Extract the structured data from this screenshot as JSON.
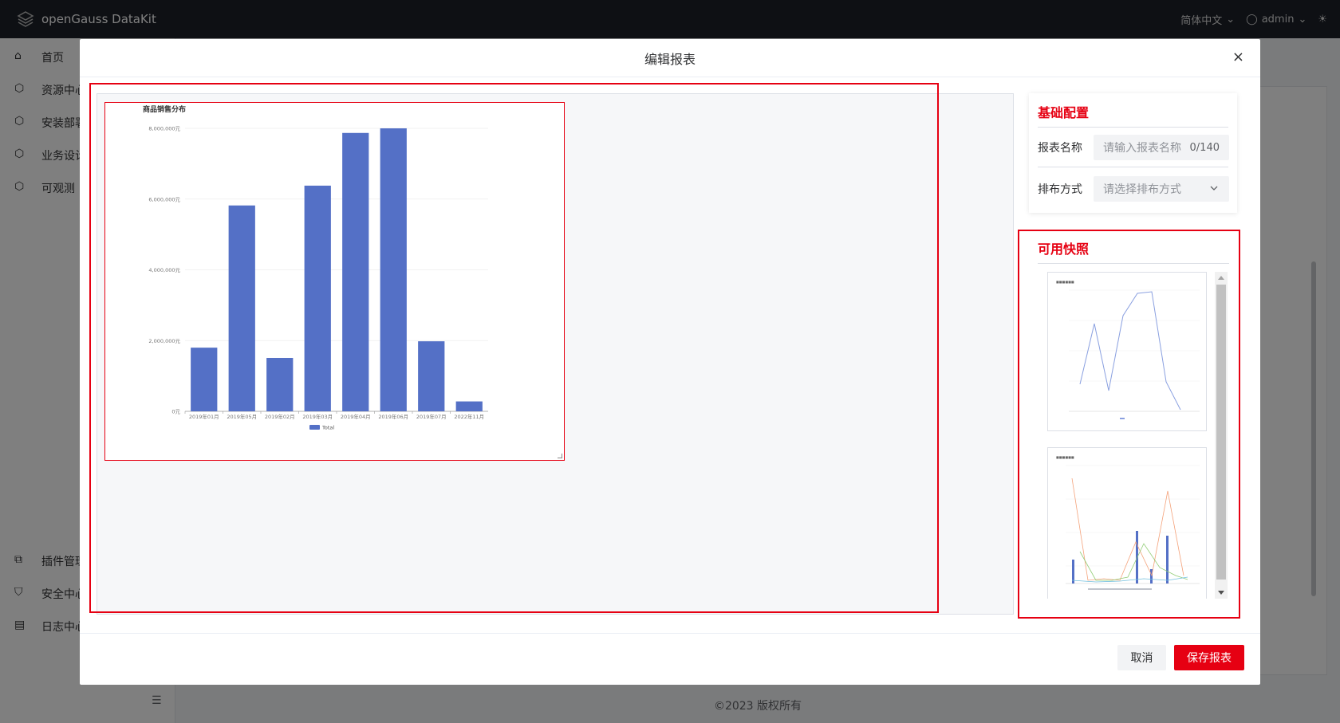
{
  "app": {
    "title": "openGauss DataKit",
    "language": "简体中文",
    "user": "admin"
  },
  "sidebar": {
    "items": [
      {
        "label": "首页",
        "icon": "home-icon"
      },
      {
        "label": "资源中心",
        "icon": "resource-icon"
      },
      {
        "label": "安装部署",
        "icon": "install-icon"
      },
      {
        "label": "业务设计",
        "icon": "design-icon"
      },
      {
        "label": "可观测",
        "icon": "observe-icon"
      },
      {
        "label": "插件管理",
        "icon": "plugin-icon"
      },
      {
        "label": "安全中心",
        "icon": "shield-icon"
      },
      {
        "label": "日志中心",
        "icon": "log-icon"
      }
    ]
  },
  "footer": {
    "copyright": "©2023 版权所有"
  },
  "modal": {
    "title": "编辑报表",
    "close": "×",
    "config": {
      "section_title": "基础配置",
      "name_label": "报表名称",
      "name_placeholder": "请输入报表名称",
      "name_count": "0/140",
      "layout_label": "排布方式",
      "layout_placeholder": "请选择排布方式"
    },
    "snapshots": {
      "section_title": "可用快照"
    },
    "buttons": {
      "cancel": "取消",
      "save": "保存报表"
    }
  },
  "colors": {
    "accent": "#e60012",
    "bar": "#5470c6",
    "topbar": "#1d2129"
  },
  "chart_data": {
    "type": "bar",
    "title": "商品销售分布",
    "categories": [
      "2019年01月",
      "2019年05月",
      "2019年02月",
      "2019年03月",
      "2019年04月",
      "2019年06月",
      "2019年07月",
      "2022年11月"
    ],
    "series": [
      {
        "name": "Total",
        "values": [
          1800000,
          5820000,
          1510000,
          6380000,
          7870000,
          8000000,
          1980000,
          280000
        ]
      }
    ],
    "ylim": [
      0,
      8000000
    ],
    "yticks": [
      "0元",
      "2,000,000元",
      "4,000,000元",
      "6,000,000元",
      "8,000,000元"
    ],
    "ytick_values": [
      0,
      2000000,
      4000000,
      6000000,
      8000000
    ],
    "grid": true,
    "legend": "bottom"
  }
}
